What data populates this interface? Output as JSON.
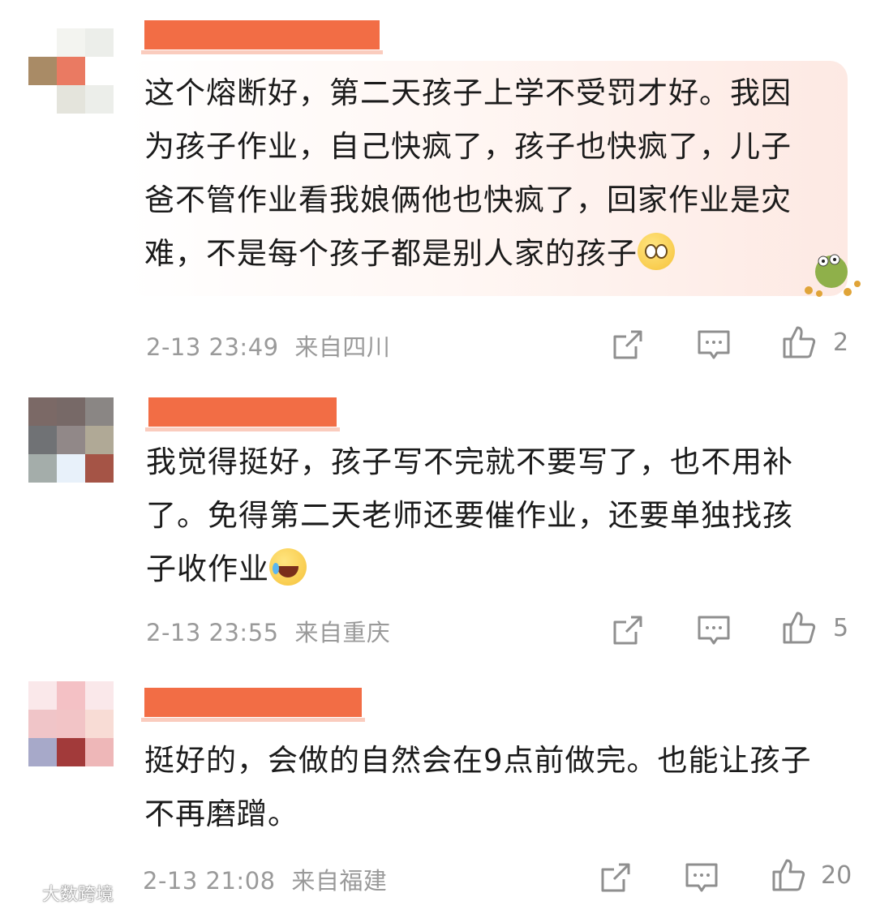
{
  "comments": [
    {
      "text": "这个熔断好，第二天孩子上学不受罚才好。我因\n为孩子作业，自己快疯了，孩子也快疯了，儿子\n爸不管作业看我娘俩他也快疯了，回家作业是灾\n难，不是每个孩子都是别人家的孩子",
      "emoji": "crying-face",
      "time": "2-13 23:49",
      "location": "来自四川",
      "likes": "2",
      "avatar_colors": [
        "#ffffff",
        "#f3f4f0",
        "#eceeea",
        "#a98b66",
        "#ea7a62",
        "#ffffff",
        "#ffffff",
        "#e4e4dc",
        "#eceeea"
      ]
    },
    {
      "text": "我觉得挺好，孩子写不完就不要写了，也不用补\n了。免得第二天老师还要催作业，还要单独找孩\n子收作业",
      "emoji": "laughing-tears-face",
      "time": "2-13 23:55",
      "location": "来自重庆",
      "likes": "5",
      "avatar_colors": [
        "#7b6966",
        "#776967",
        "#8a8684",
        "#707275",
        "#918888",
        "#b0a996",
        "#a4adaa",
        "#e8f1fa",
        "#a55446"
      ]
    },
    {
      "text": "挺好的，会做的自然会在9点前做完。也能让孩子\n不再磨蹭。",
      "emoji": "",
      "time": "2-13 21:08",
      "location": "来自福建",
      "likes": "20",
      "avatar_colors": [
        "#fae8ea",
        "#f4c1c5",
        "#fae8ea",
        "#f0c5c8",
        "#f2c4c6",
        "#f8dcd5",
        "#a7a9c9",
        "#a23a3a",
        "#eeb7b8"
      ]
    }
  ],
  "watermark": "大数跨境",
  "colors": {
    "username_redaction": "#f26d45",
    "meta_text": "#9a9a9a"
  }
}
